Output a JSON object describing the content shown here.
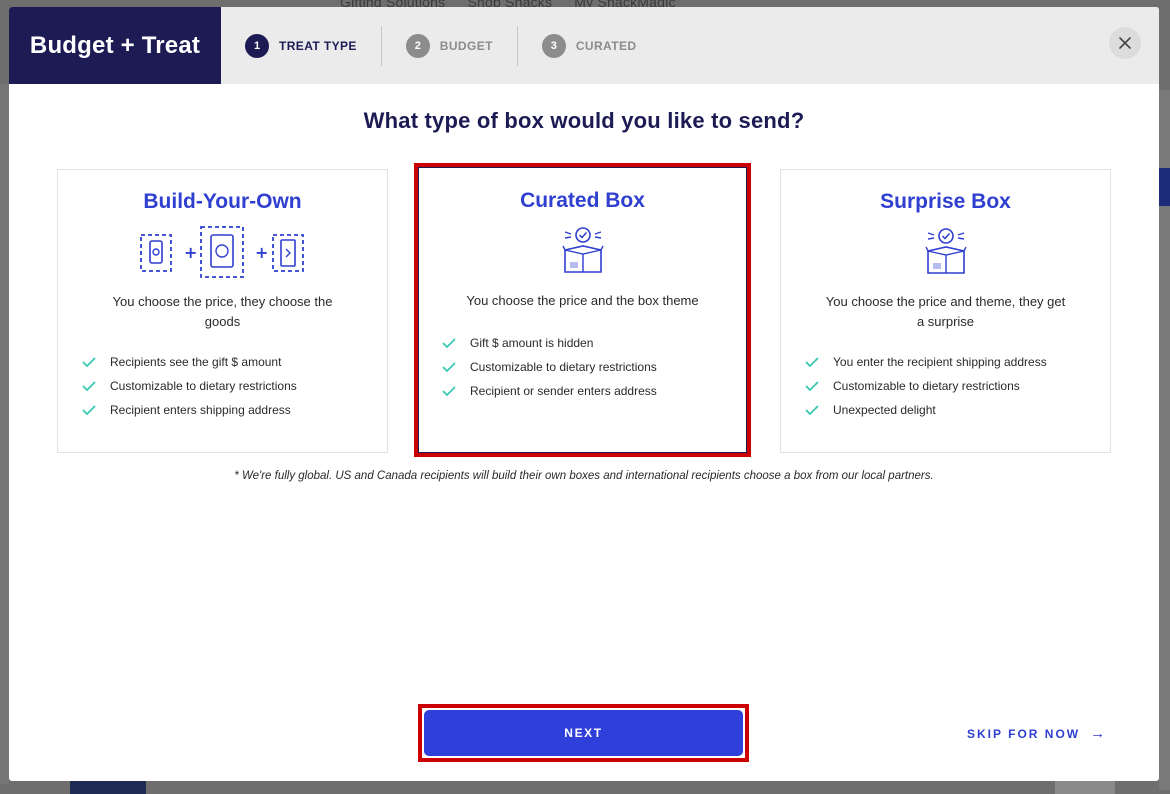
{
  "background": {
    "nav_items": [
      "Gifting Solutions",
      "Shop Snacks",
      "My SnackMagic"
    ]
  },
  "header": {
    "brand": "Budget + Treat",
    "steps": [
      {
        "number": "1",
        "label": "TREAT TYPE",
        "active": true
      },
      {
        "number": "2",
        "label": "BUDGET",
        "active": false
      },
      {
        "number": "3",
        "label": "CURATED",
        "active": false
      }
    ],
    "close_icon": "close-icon"
  },
  "main": {
    "title": "What type of box would you like to send?",
    "cards": [
      {
        "title": "Build-Your-Own",
        "icon": "build-your-own-icon",
        "description": "You choose the price, they choose the goods",
        "features": [
          "Recipients see the gift $ amount",
          "Customizable to dietary restrictions",
          "Recipient enters shipping address"
        ],
        "selected": false
      },
      {
        "title": "Curated Box",
        "icon": "curated-box-icon",
        "description": "You choose the price and the box theme",
        "features": [
          "Gift $ amount is hidden",
          "Customizable to dietary restrictions",
          "Recipient or sender enters address"
        ],
        "selected": true
      },
      {
        "title": "Surprise Box",
        "icon": "surprise-box-icon",
        "description": "You choose the price and theme, they get a surprise",
        "features": [
          "You enter the recipient shipping address",
          "Customizable to dietary restrictions",
          "Unexpected delight"
        ],
        "selected": false
      }
    ],
    "footnote": "* We're fully global. US and Canada recipients will build their own boxes and international recipients choose a box from our local partners."
  },
  "footer": {
    "next_label": "NEXT",
    "skip_label": "SKIP FOR NOW",
    "skip_arrow": "→"
  },
  "colors": {
    "brand_navy": "#1d1b54",
    "accent_blue": "#2f3fd9",
    "check_teal": "#3cc7b0",
    "highlight_red": "#cc0000"
  }
}
